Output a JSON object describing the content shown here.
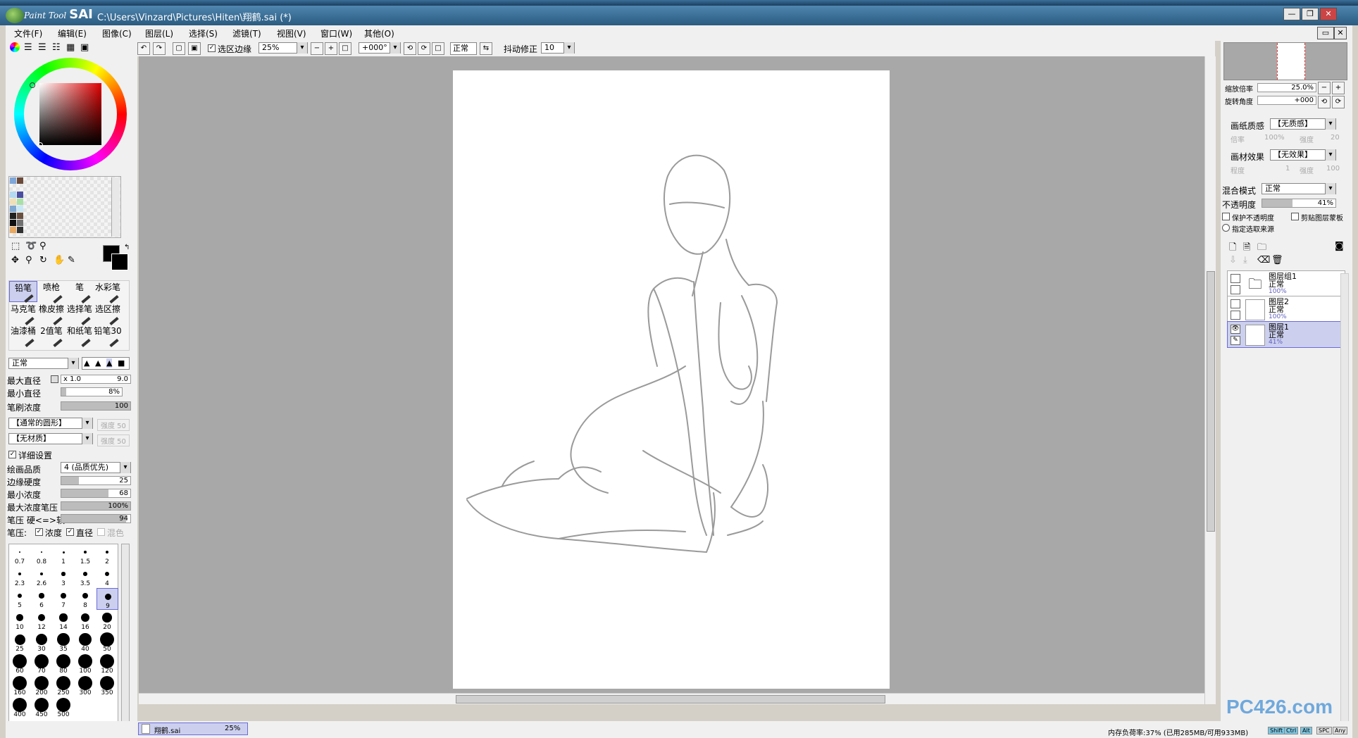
{
  "window": {
    "brand_prefix": "Paint Tool",
    "brand_name": "SAI",
    "title_path": "C:\\Users\\Vinzard\\Pictures\\Hiten\\翔鹤.sai (*)",
    "minimize": "—",
    "restore": "❐",
    "close": "✕"
  },
  "menu": [
    "文件(F)",
    "编辑(E)",
    "图像(C)",
    "图层(L)",
    "选择(S)",
    "滤镜(T)",
    "视图(V)",
    "窗口(W)",
    "其他(O)"
  ],
  "toolbar": {
    "selection_edge_label": "选区边缘",
    "selection_edge_checked": true,
    "zoom": "25%",
    "rotation": "+000°",
    "blend": "正常",
    "stabilizer_label": "抖动修正",
    "stabilizer_value": "10"
  },
  "tools": {
    "row1": [
      "铅笔",
      "喷枪",
      "笔",
      "水彩笔"
    ],
    "row2": [
      "马克笔",
      "橡皮擦",
      "选择笔",
      "选区擦"
    ],
    "row3": [
      "油漆桶",
      "2值笔",
      "和纸笔",
      "铅笔30"
    ],
    "selected": "铅笔"
  },
  "brush": {
    "blend_mode": "正常",
    "max_diameter_label": "最大直径",
    "max_diameter_mult": "x 1.0",
    "max_diameter_value": "9.0",
    "min_diameter_label": "最小直径",
    "min_diameter_value": "8%",
    "min_diameter_fill": 0.08,
    "density_label": "笔刷浓度",
    "density_value": "100",
    "density_fill": 1.0,
    "shape": "【通常的圆形】",
    "shape_strength": "强度  50",
    "texture": "【无材质】",
    "texture_strength": "强度  50",
    "detail_label": "详细设置",
    "detail_checked": true,
    "quality_label": "绘画品质",
    "quality_value": "4 (品质优先)",
    "edge_hardness_label": "边缘硬度",
    "edge_hardness_value": "25",
    "edge_hardness_fill": 0.25,
    "min_density_label": "最小浓度",
    "min_density_value": "68",
    "min_density_fill": 0.68,
    "max_density_pressure_label": "最大浓度笔压",
    "max_density_pressure_value": "100%",
    "max_density_pressure_fill": 1.0,
    "pressure_label": "笔压 硬<=>软",
    "pressure_value": "94",
    "pressure_fill": 0.94,
    "pressure_opts_label": "笔压:",
    "opt_density": "浓度",
    "opt_diameter": "直径",
    "opt_blend": "混色"
  },
  "brush_sizes": [
    "0.7",
    "0.8",
    "1",
    "1.5",
    "2",
    "2.3",
    "2.6",
    "3",
    "3.5",
    "4",
    "5",
    "6",
    "7",
    "8",
    "9",
    "10",
    "12",
    "14",
    "16",
    "20",
    "25",
    "30",
    "35",
    "40",
    "50",
    "60",
    "70",
    "80",
    "100",
    "120",
    "160",
    "200",
    "250",
    "300",
    "350",
    "400",
    "450",
    "500"
  ],
  "selected_brush_size": "9",
  "navigator": {
    "zoom_label": "缩放倍率",
    "zoom_value": "25.0%",
    "angle_label": "旋转角度",
    "angle_value": "+000"
  },
  "paper": {
    "texture_label": "画纸质感",
    "texture_value": "【无质感】",
    "scale_label": "倍率",
    "scale_value": "100%",
    "strength_label": "强度",
    "strength_value": "20",
    "effect_label": "画材效果",
    "effect_value": "【无效果】",
    "degree_label": "程度",
    "degree_value": "1",
    "strength2_label": "强度",
    "strength2_value": "100"
  },
  "layer_props": {
    "blend_label": "混合模式",
    "blend_value": "正常",
    "opacity_label": "不透明度",
    "opacity_value": "41%",
    "opacity_fill": 0.41,
    "protect_label": "保护不透明度",
    "clip_label": "剪贴图层蒙板",
    "source_label": "指定选取来源"
  },
  "layers": [
    {
      "name": "图层组1",
      "mode": "正常",
      "opacity": "100%",
      "type": "folder",
      "selected": false
    },
    {
      "name": "图层2",
      "mode": "正常",
      "opacity": "100%",
      "type": "layer",
      "selected": false
    },
    {
      "name": "图层1",
      "mode": "正常",
      "opacity": "41%",
      "type": "layer",
      "selected": true
    }
  ],
  "document_tab": {
    "name": "翔鹤.sai",
    "zoom": "25%"
  },
  "status": {
    "memory": "内存负荷率:37% (已用285MB/可用933MB)",
    "keys": [
      "Shift",
      "Ctrl",
      "Alt",
      "SPC",
      "Any"
    ]
  },
  "watermark": "PC426.com",
  "colors": {
    "accent_select": "#ccd0ee",
    "canvas_bg": "#a8a8a8",
    "title_bg": "#2b5b80"
  }
}
